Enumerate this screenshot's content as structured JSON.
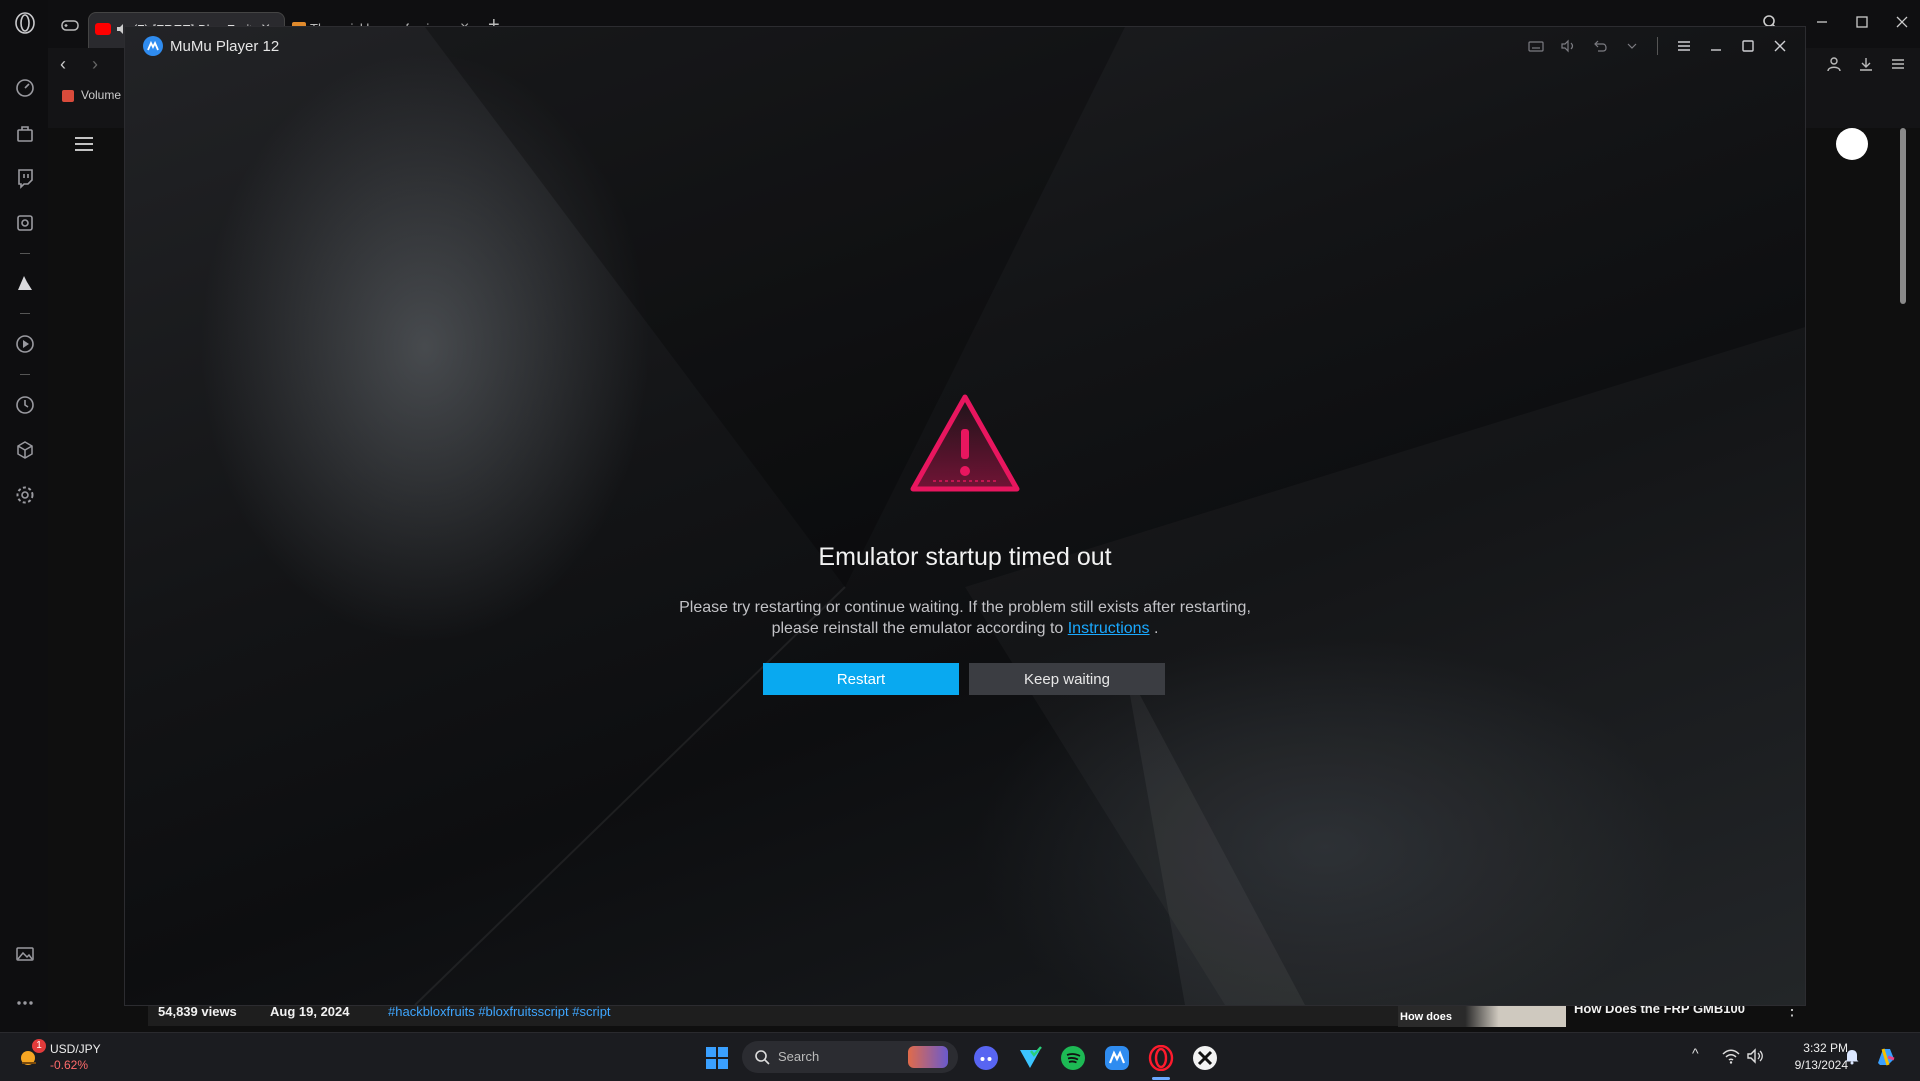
{
  "browser": {
    "tabs": [
      {
        "label": "(7) [FREE] Blox Fruits Sc"
      },
      {
        "label": "The quickbrown fox jumps"
      }
    ],
    "bookmark": "Volume"
  },
  "youtube": {
    "views": "54,839 views",
    "date": "Aug 19, 2024",
    "hashtags": "#hackbloxfruits #bloxfruitsscript #script",
    "thumb_text": "How does",
    "related_title": "How Does the FRP GMB100"
  },
  "emulator": {
    "title": "MuMu Player 12",
    "dialog": {
      "title": "Emulator startup timed out",
      "message_before": "Please try restarting or continue waiting. If the problem still exists after restarting, please reinstall the emulator according to",
      "link": "Instructions",
      "message_after": " .",
      "restart": "Restart",
      "keep_waiting": "Keep waiting"
    },
    "accent_color": "#09a9f0",
    "warning_color": "#e8165f"
  },
  "taskbar": {
    "ticker_symbol": "USD/JPY",
    "ticker_change": "-0.62%",
    "ticker_badge": "1",
    "search_placeholder": "Search",
    "time": "3:32 PM",
    "date": "9/13/2024"
  }
}
